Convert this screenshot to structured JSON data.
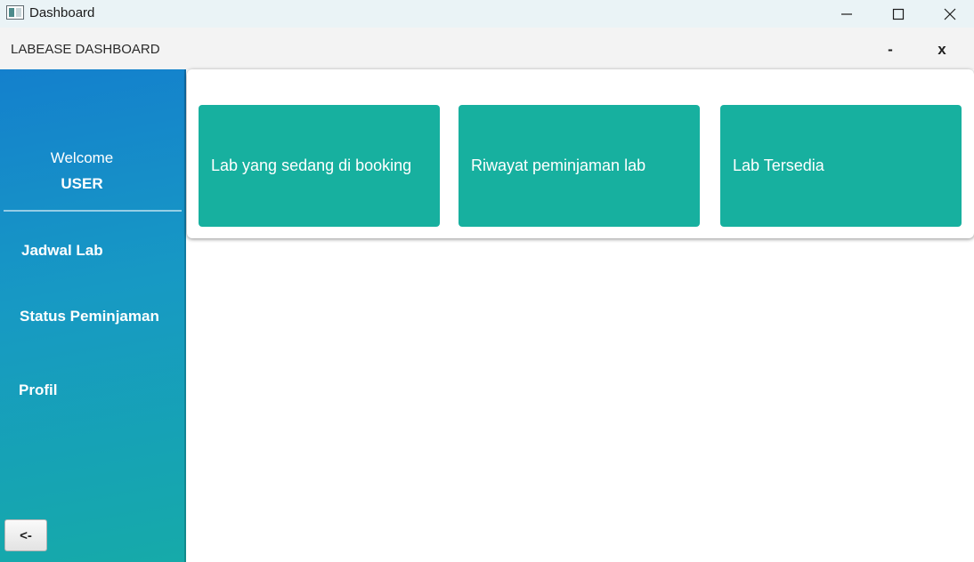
{
  "window": {
    "title": "Dashboard",
    "icons": {
      "app": "app-window-icon",
      "minimize": "minimize-icon",
      "maximize": "maximize-icon",
      "close": "close-icon"
    }
  },
  "header": {
    "title": "LABEASE DASHBOARD",
    "minimize_label": "-",
    "close_label": "x"
  },
  "sidebar": {
    "welcome": "Welcome",
    "user": "USER",
    "items": [
      {
        "label": "Jadwal Lab"
      },
      {
        "label": "Status Peminjaman"
      },
      {
        "label": "Profil"
      }
    ],
    "back_label": "<-"
  },
  "main": {
    "tiles": [
      {
        "label": "Lab yang sedang di booking"
      },
      {
        "label": "Riwayat peminjaman lab"
      },
      {
        "label": "Lab Tersedia"
      }
    ]
  },
  "colors": {
    "sidebar_top": "#1480cd",
    "sidebar_bottom": "#16aaa9",
    "tile": "#17b09f",
    "header_bg": "#f3f3f3",
    "titlebar_bg": "#eaf3f6"
  }
}
